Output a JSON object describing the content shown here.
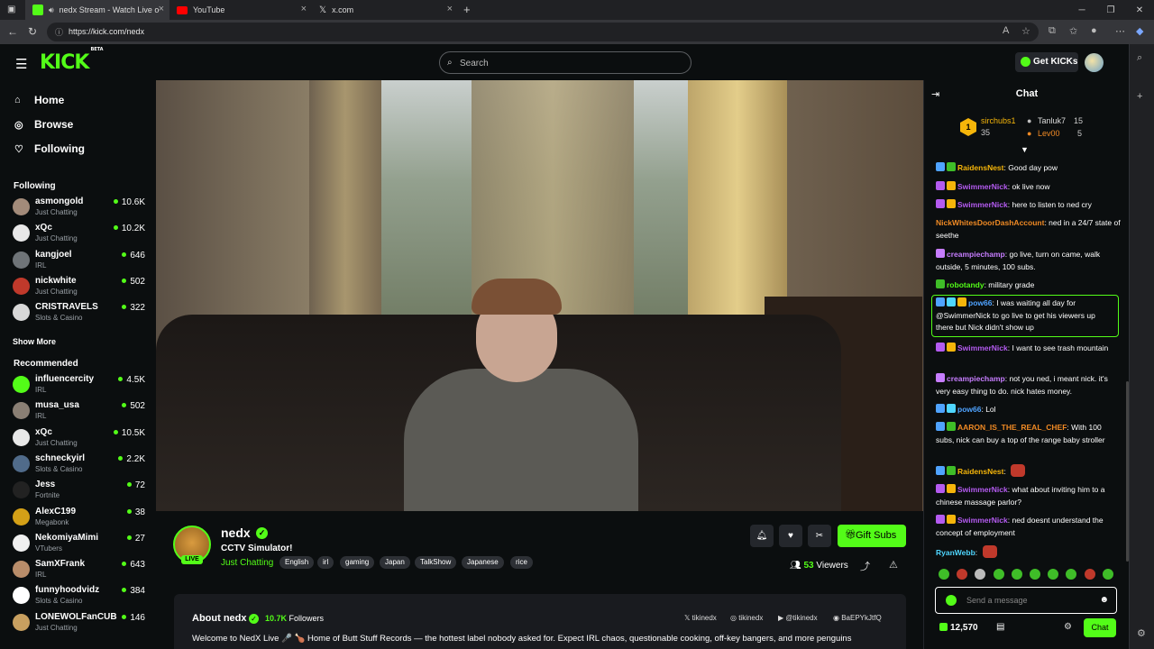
{
  "browser": {
    "tabs": [
      {
        "title": "nedx Stream - Watch Live on Kick",
        "active": true,
        "color": "#53fc18"
      },
      {
        "title": "YouTube",
        "active": false,
        "color": "#ff0000"
      },
      {
        "title": "x.com",
        "active": false,
        "color": "#ffffff"
      }
    ],
    "url": "https://kick.com/nedx"
  },
  "header": {
    "logo": "KICK",
    "logo_sup": "BETA",
    "search_placeholder": "Search",
    "get_kicks": "Get KICKs"
  },
  "nav": {
    "home": "Home",
    "browse": "Browse",
    "following": "Following"
  },
  "following_section": "Following",
  "following_channels": [
    {
      "name": "asmongold",
      "category": "Just Chatting",
      "viewers": "10.6K",
      "color": "#a38b7a"
    },
    {
      "name": "xQc",
      "category": "Just Chatting",
      "viewers": "10.2K",
      "color": "#e8e8e8"
    },
    {
      "name": "kangjoel",
      "category": "IRL",
      "viewers": "646",
      "color": "#6f7478"
    },
    {
      "name": "nickwhite",
      "category": "Just Chatting",
      "viewers": "502",
      "color": "#c0392b"
    },
    {
      "name": "CRISTRAVELS",
      "category": "Slots & Casino",
      "viewers": "322",
      "color": "#d8d8d8"
    }
  ],
  "show_more": "Show More",
  "recommended_section": "Recommended",
  "recommended_channels": [
    {
      "name": "influencercity",
      "category": "IRL",
      "viewers": "4.5K",
      "color": "#53fc18"
    },
    {
      "name": "musa_usa",
      "category": "IRL",
      "viewers": "502",
      "color": "#8a7f74"
    },
    {
      "name": "xQc",
      "category": "Just Chatting",
      "viewers": "10.5K",
      "color": "#e8e8e8"
    },
    {
      "name": "schneckyirl",
      "category": "Slots & Casino",
      "viewers": "2.2K",
      "color": "#506b8a"
    },
    {
      "name": "Jess",
      "category": "Fortnite",
      "viewers": "72",
      "color": "#222222"
    },
    {
      "name": "AlexC199",
      "category": "Megabonk",
      "viewers": "38",
      "color": "#d4a017"
    },
    {
      "name": "NekomiyaMimi",
      "category": "VTubers",
      "viewers": "27",
      "color": "#f0f0f0"
    },
    {
      "name": "SamXFrank",
      "category": "IRL",
      "viewers": "643",
      "color": "#b98d6a"
    },
    {
      "name": "funnyhoodvidz",
      "category": "Slots & Casino",
      "viewers": "384",
      "color": "#ffffff"
    },
    {
      "name": "LONEWOLFanCUB",
      "category": "Just Chatting",
      "viewers": "146",
      "color": "#c8a060"
    }
  ],
  "channel": {
    "name": "nedx",
    "live_badge": "LIVE",
    "title": "CCTV Simulator!",
    "category": "Just Chatting",
    "tags": [
      "English",
      "irl",
      "gaming",
      "Japan",
      "TalkShow",
      "Japanese",
      "rice"
    ],
    "gift_subs": "Gift Subs",
    "viewers": "53",
    "viewers_label": "Viewers"
  },
  "about": {
    "title": "About nedx",
    "followers_count": "10.7K",
    "followers_label": "Followers",
    "socials": [
      "tikinedx",
      "tikinedx",
      "@tikinedx",
      "BaEPYkJtfQ"
    ],
    "description": "Welcome to NedX Live 🎤 🍗 Home of Butt Stuff Records — the hottest label nobody asked for. Expect IRL chaos, questionable cooking, off-key bangers, and more penguins"
  },
  "chat": {
    "title": "Chat",
    "top_gifters": [
      {
        "rank": "1",
        "name": "sirchubs1",
        "count": "35",
        "color": "#f5b50a"
      },
      {
        "rank": "2",
        "name": "Tanluk7",
        "count": "15",
        "color": "#c0c0c0"
      },
      {
        "rank": "3",
        "name": "Lev00",
        "count": "5",
        "color": "#f08a24"
      }
    ],
    "messages": [
      {
        "user": "RaidensNest",
        "color": "#f5b50a",
        "text": "Good day pow"
      },
      {
        "user": "SwimmerNick",
        "color": "#b45bf0",
        "text": "ok live now"
      },
      {
        "user": "SwimmerNick",
        "color": "#b45bf0",
        "text": "here to listen to ned cry"
      },
      {
        "user": "NickWhitesDoorDashAccount",
        "color": "#f08a24",
        "text": "ned in a 24/7 state of seethe"
      },
      {
        "user": "creampiechamp",
        "color": "#c77dff",
        "text": "go live, turn on came, walk outside, 5 minutes, 100 subs."
      },
      {
        "user": "robotandy",
        "color": "#53fc18",
        "text": "military grade"
      },
      {
        "user": "pow66",
        "color": "#4fa3ff",
        "text": "I was waiting all day for @SwimmerNick to go live to get his viewers up there but Nick didn't show up"
      },
      {
        "user": "SwimmerNick",
        "color": "#b45bf0",
        "text": "I want to see trash mountain"
      },
      {
        "user": "creampiechamp",
        "color": "#c77dff",
        "text": "not you ned, i meant nick. it's very easy thing to do. nick hates money."
      },
      {
        "user": "pow66",
        "color": "#4fa3ff",
        "text": "Lol"
      },
      {
        "user": "AARON_IS_THE_REAL_CHEF",
        "color": "#f08a24",
        "text": "With 100 subs, nick can buy a top of the range baby stroller"
      },
      {
        "user": "RaidensNest",
        "color": "#f5b50a",
        "text": ""
      },
      {
        "user": "SwimmerNick",
        "color": "#b45bf0",
        "text": "what about inviting him to a chinese massage parlor?"
      },
      {
        "user": "SwimmerNick",
        "color": "#b45bf0",
        "text": "ned doesnt understand the concept of employment"
      },
      {
        "user": "RyanWebb",
        "color": "#4fd6ff",
        "text": ""
      }
    ],
    "input_placeholder": "Send a message",
    "kicks_balance": "12,570",
    "send_button": "Chat"
  },
  "colors": {
    "accent": "#53fc18",
    "background": "#0b0e0f",
    "panel": "#191b1f"
  }
}
